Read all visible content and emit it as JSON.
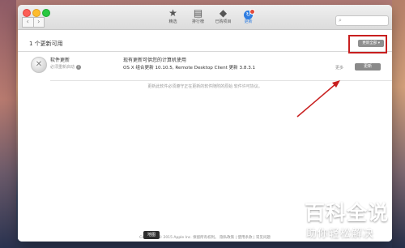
{
  "toolbar": {
    "nav_back": "‹",
    "nav_forward": "›",
    "tabs": [
      {
        "label": "精选",
        "icon": "star-icon"
      },
      {
        "label": "排行榜",
        "icon": "chart-list-icon"
      },
      {
        "label": "已购项目",
        "icon": "tag-icon"
      },
      {
        "label": "更新",
        "icon": "updates-icon"
      }
    ],
    "search_placeholder": ""
  },
  "updates": {
    "section_title": "1 个更新可用",
    "update_all_label": "更新全部 ▾",
    "app": {
      "name": "软件更新",
      "subtitle": "必须重新启动",
      "desc_line1": "现有更新可供您的计算机使用",
      "desc_line2": "OS X 组合更新 10.10.5, Remote Desktop Client 更新 3.8.3.1",
      "more_label": "更多",
      "update_label": "更新"
    },
    "footer_note": "更新此软件必须遵守正在更新的软件随附的原始 软件许可协议。"
  },
  "bottom": {
    "links": "Copyright © 2015 Apple Inc. 保留所有权利。 隐私政策 | 使用条款 | 常见问题",
    "map_tooltip": "地图"
  },
  "watermark": {
    "line1": "百科全说",
    "line2": "助你轻松解决"
  },
  "colors": {
    "highlight": "#c81f1f",
    "accent": "#2f7de1"
  }
}
